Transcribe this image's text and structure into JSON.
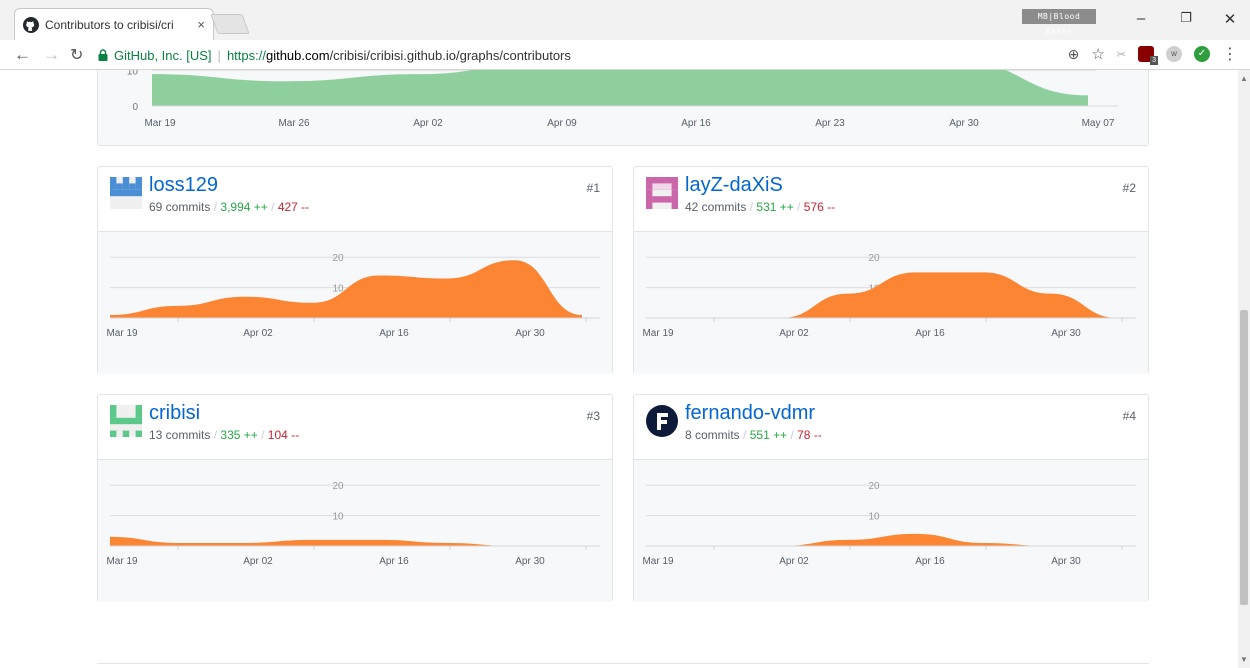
{
  "browser": {
    "tab_title": "Contributors to cribisi/cri",
    "tab_close": "×",
    "extension_badge": "MB|Blood Eater",
    "origin": "GitHub, Inc. [US]",
    "url_scheme": "https://",
    "url_host": "github.com",
    "url_path": "/cribisi/cribisi.github.io/graphs/contributors",
    "ext_badge_count": "3",
    "ext_w_label": "w"
  },
  "overview": {
    "y_ticks": [
      "10",
      "0"
    ],
    "x_ticks": [
      "Mar 19",
      "Mar 26",
      "Apr 02",
      "Apr 09",
      "Apr 16",
      "Apr 23",
      "Apr 30",
      "May 07"
    ]
  },
  "contributors": [
    {
      "login": "loss129",
      "rank": "#1",
      "commits": "69 commits",
      "additions": "3,994 ++",
      "deletions": "427 --",
      "color": "#4a8fd6"
    },
    {
      "login": "layZ-daXiS",
      "rank": "#2",
      "commits": "42 commits",
      "additions": "531 ++",
      "deletions": "576 --",
      "color": "#cc66aa"
    },
    {
      "login": "cribisi",
      "rank": "#3",
      "commits": "13 commits",
      "additions": "335 ++",
      "deletions": "104 --",
      "color": "#5cc98a"
    },
    {
      "login": "fernando-vdmr",
      "rank": "#4",
      "commits": "8 commits",
      "additions": "551 ++",
      "deletions": "78 --",
      "color": "#0e1a3a"
    }
  ],
  "card_chart": {
    "y_ticks": [
      "20",
      "10"
    ],
    "x_ticks": [
      "Mar 19",
      "Apr 02",
      "Apr 16",
      "Apr 30"
    ]
  },
  "chart_data": [
    {
      "type": "area",
      "x": [
        "Mar 19",
        "Mar 26",
        "Apr 02",
        "Apr 09",
        "Apr 16",
        "Apr 23",
        "Apr 30",
        "May 07"
      ],
      "series": [
        {
          "values": [
            9,
            7,
            9,
            13,
            13,
            13,
            13,
            3
          ]
        }
      ],
      "ylim": [
        0,
        13
      ],
      "color": "#8fcf9e"
    },
    {
      "type": "area",
      "x": [
        "Mar 19",
        "Mar 26",
        "Apr 02",
        "Apr 09",
        "Apr 16",
        "Apr 23",
        "Apr 30",
        "May 07"
      ],
      "series": [
        {
          "name": "loss129",
          "values": [
            1,
            4,
            7,
            5,
            14,
            13,
            19,
            1
          ]
        }
      ],
      "ylim": [
        0,
        25
      ],
      "color": "#fb8532"
    },
    {
      "type": "area",
      "x": [
        "Mar 19",
        "Mar 26",
        "Apr 02",
        "Apr 09",
        "Apr 16",
        "Apr 23",
        "Apr 30",
        "May 07"
      ],
      "series": [
        {
          "name": "layZ-daXiS",
          "values": [
            0,
            0,
            0,
            8,
            15,
            15,
            8,
            0
          ]
        }
      ],
      "ylim": [
        0,
        25
      ],
      "color": "#fb8532"
    },
    {
      "type": "area",
      "x": [
        "Mar 19",
        "Mar 26",
        "Apr 02",
        "Apr 09",
        "Apr 16",
        "Apr 23",
        "Apr 30",
        "May 07"
      ],
      "series": [
        {
          "name": "cribisi",
          "values": [
            3,
            1,
            1,
            2,
            2,
            1,
            0,
            0
          ]
        }
      ],
      "ylim": [
        0,
        25
      ],
      "color": "#fb8532"
    },
    {
      "type": "area",
      "x": [
        "Mar 19",
        "Mar 26",
        "Apr 02",
        "Apr 09",
        "Apr 16",
        "Apr 23",
        "Apr 30",
        "May 07"
      ],
      "series": [
        {
          "name": "fernando-vdmr",
          "values": [
            0,
            0,
            0,
            2,
            4,
            1,
            0,
            0
          ]
        }
      ],
      "ylim": [
        0,
        25
      ],
      "color": "#fb8532"
    }
  ]
}
